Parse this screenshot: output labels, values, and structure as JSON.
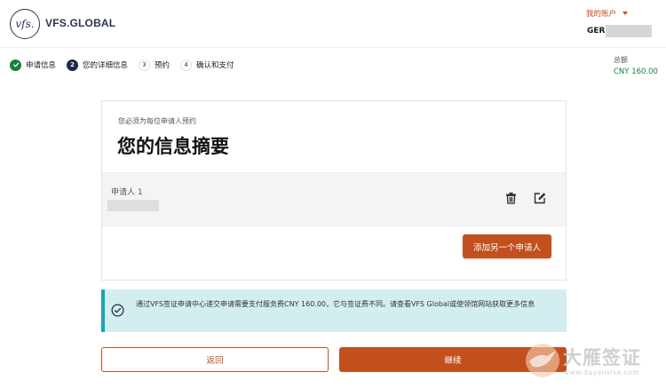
{
  "brand": {
    "logo_glyph": "vfs.",
    "name": "VFS.GLOBAL"
  },
  "account": {
    "menu_label": "我的账户",
    "user_prefix": "GER"
  },
  "steps": [
    {
      "num": "✓",
      "label": "申请信息",
      "state": "done"
    },
    {
      "num": "2",
      "label": "您的详细信息",
      "state": "active"
    },
    {
      "num": "3",
      "label": "预约",
      "state": "todo"
    },
    {
      "num": "4",
      "label": "确认和支付",
      "state": "todo"
    }
  ],
  "total": {
    "label": "总额",
    "amount": "CNY 160.00"
  },
  "summary": {
    "subtitle": "您必须为每位申请人预约",
    "title": "您的信息摘要",
    "applicant_label": "申请人 1",
    "add_button": "添加另一个申请人"
  },
  "info": {
    "text": "通过VFS签证申请中心递交申请需要支付服务费CNY 160.00，它与签证费不同。请查看VFS Global或使领馆网站获取更多信息"
  },
  "actions": {
    "back": "返回",
    "continue": "继续"
  },
  "watermark": {
    "text": "大雁签证",
    "url": "www.dayanvisa.com"
  },
  "colors": {
    "accent": "#c1501e",
    "success": "#15803d",
    "info_bg": "#d3eef1",
    "info_border": "#1aa3b3",
    "navy": "#1f2a44"
  }
}
